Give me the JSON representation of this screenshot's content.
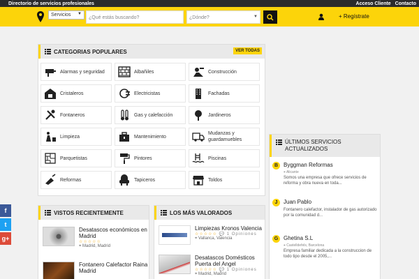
{
  "topbar": {
    "title": "Directorio de servicios profesionales",
    "links": [
      "Acceso Cliente",
      "Contacto"
    ]
  },
  "search": {
    "category": "Servicios",
    "what_placeholder": "¿Qué estás buscando?",
    "where_placeholder": "¿Dónde?",
    "register_label": "+ Regístrate"
  },
  "categories": {
    "title": "CATEGORIAS POPULARES",
    "see_all": "VER TODAS",
    "items": [
      {
        "label": "Alarmas y seguridad",
        "icon": "camera-icon"
      },
      {
        "label": "Albañiles",
        "icon": "brick-wall-icon"
      },
      {
        "label": "Construcción",
        "icon": "construction-icon"
      },
      {
        "label": "Cristaleros",
        "icon": "house-window-icon"
      },
      {
        "label": "Electricistas",
        "icon": "plug-icon"
      },
      {
        "label": "Fachadas",
        "icon": "building-icon"
      },
      {
        "label": "Fontaneros",
        "icon": "tools-icon"
      },
      {
        "label": "Gas y calefacción",
        "icon": "thermometer-icon"
      },
      {
        "label": "Jardineros",
        "icon": "tree-icon"
      },
      {
        "label": "Limpieza",
        "icon": "cleaning-icon"
      },
      {
        "label": "Mantenimiento",
        "icon": "toolbox-icon"
      },
      {
        "label": "Mudanzas y guardamuebles",
        "icon": "truck-icon"
      },
      {
        "label": "Parquetistas",
        "icon": "parquet-icon"
      },
      {
        "label": "Pintores",
        "icon": "paint-roller-icon"
      },
      {
        "label": "Piscinas",
        "icon": "pool-icon"
      },
      {
        "label": "Reformas",
        "icon": "trowel-icon"
      },
      {
        "label": "Tapiceros",
        "icon": "armchair-icon"
      },
      {
        "label": "Toldos",
        "icon": "awning-icon"
      }
    ]
  },
  "recent": {
    "title": "VISTOS RECIENTEMENTE",
    "items": [
      {
        "title": "Desatascos económicos en Madrid",
        "stars": "☆☆☆☆☆",
        "location": "Madrid, Madrid"
      },
      {
        "title": "Fontanero Calefactor Raina Madrid",
        "stars": "",
        "location": ""
      }
    ]
  },
  "top_rated": {
    "title": "LOS MÁS VALORADOS",
    "items": [
      {
        "title": "Limpiezas Kronos Valencia",
        "stars": "☆☆☆☆☆",
        "opinions": "1 Opiniones",
        "location": "Vallanca, Valencia"
      },
      {
        "title": "Desatascos Domésticos Puerta del Angel",
        "stars": "☆☆☆☆☆",
        "opinions": "1 Opiniones",
        "location": "Madrid, Madrid"
      }
    ]
  },
  "latest": {
    "title": "ÚLTIMOS SERVICIOS ACTUALIZADOS",
    "items": [
      {
        "letter": "B",
        "name": "Byggman Reformas",
        "location": "Alicante",
        "desc": "Somos una empresa que ofrece servicios de reforma y obra nueva en toda..."
      },
      {
        "letter": "J",
        "name": "Juan Pablo",
        "location": "",
        "desc": "Fontanero calefactor, instalador de gas autorizado por la comunidad d..."
      },
      {
        "letter": "G",
        "name": "Ghetina S.L",
        "location": "Castelldefels, Barcelona",
        "desc": "Empresa familiar dedicada a la construccion de todo tipo desde el 2005,..."
      }
    ]
  },
  "social": [
    "f",
    "t",
    "g+"
  ],
  "colors": {
    "accent": "#fcd40a",
    "dark": "#2b2b2b",
    "facebook": "#3b5998",
    "twitter": "#1da1f2",
    "google": "#dd4b39"
  }
}
